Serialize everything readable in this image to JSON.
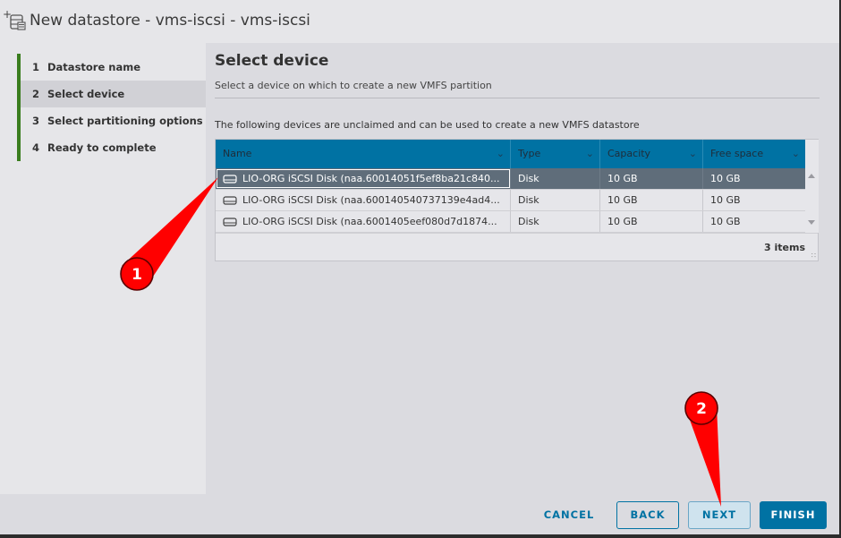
{
  "dialog": {
    "title": "New datastore - vms-iscsi - vms-iscsi",
    "title_icon": "new-datastore-icon"
  },
  "steps": [
    {
      "num": "1",
      "label": "Datastore name",
      "active": false
    },
    {
      "num": "2",
      "label": "Select device",
      "active": true
    },
    {
      "num": "3",
      "label": "Select partitioning options",
      "active": false
    },
    {
      "num": "4",
      "label": "Ready to complete",
      "active": false
    }
  ],
  "main": {
    "title": "Select device",
    "subtitle": "Select a device on which to create a new VMFS partition",
    "caption": "The following devices are unclaimed and can be used to create a new VMFS datastore"
  },
  "grid": {
    "columns": [
      "Name",
      "Type",
      "Capacity",
      "Free space"
    ],
    "rows": [
      {
        "name": "LIO-ORG iSCSI Disk (naa.60014051f5ef8ba21c840...",
        "type": "Disk",
        "capacity": "10 GB",
        "free": "10 GB",
        "selected": true
      },
      {
        "name": "LIO-ORG iSCSI Disk (naa.600140540737139e4ad4...",
        "type": "Disk",
        "capacity": "10 GB",
        "free": "10 GB",
        "selected": false
      },
      {
        "name": "LIO-ORG iSCSI Disk (naa.6001405eef080d7d1874...",
        "type": "Disk",
        "capacity": "10 GB",
        "free": "10 GB",
        "selected": false
      }
    ],
    "items_count": "3 items"
  },
  "footer": {
    "cancel_label": "CANCEL",
    "back_label": "BACK",
    "next_label": "NEXT",
    "finish_label": "FINISH"
  },
  "annotations": {
    "marker_1": "1",
    "marker_2": "2",
    "marker_color": "#ff0000"
  },
  "colors": {
    "accent": "#0072a3",
    "step_progress": "#3a7d1e",
    "selected_row": "#5f6d7a"
  }
}
